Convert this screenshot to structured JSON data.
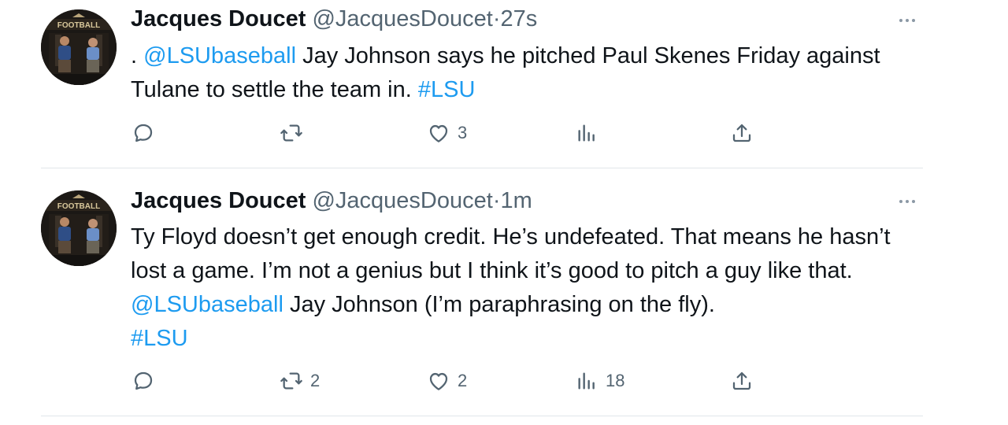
{
  "tweets": [
    {
      "author": {
        "display_name": "Jacques Doucet",
        "handle": "@JacquesDoucet"
      },
      "separator": "·",
      "time": "27s",
      "text": {
        "lead": ".",
        "mention": "@LSUbaseball",
        "after_mention": "Jay Johnson says he pitched Paul Skenes Friday against Tulane to settle the team in.",
        "hashtag": "#LSU"
      },
      "counts": {
        "replies": "",
        "retweets": "",
        "likes": "3",
        "views": ""
      }
    },
    {
      "author": {
        "display_name": "Jacques Doucet",
        "handle": "@JacquesDoucet"
      },
      "separator": "·",
      "time": "1m",
      "text": {
        "before_mention": "Ty Floyd doesn’t get enough credit. He’s undefeated. That means he hasn’t lost a game. I’m not a genius but I think it’s good to pitch a guy like that.",
        "mention": "@LSUbaseball",
        "after_mention": "Jay Johnson (I’m paraphrasing on the fly).",
        "hashtag": "#LSU"
      },
      "counts": {
        "replies": "",
        "retweets": "2",
        "likes": "2",
        "views": "18"
      }
    }
  ],
  "avatar": {
    "banner_text": "FOOTBALL"
  },
  "colors": {
    "link": "#1d9bf0",
    "secondary_text": "#536471",
    "primary_text": "#0f1419",
    "divider": "#e1e6ea"
  },
  "icons": {
    "reply": "speech-bubble-icon",
    "retweet": "retweet-arrows-icon",
    "like": "heart-icon",
    "views": "bar-chart-icon",
    "share": "upload-arrow-icon",
    "more": "ellipsis-icon"
  }
}
